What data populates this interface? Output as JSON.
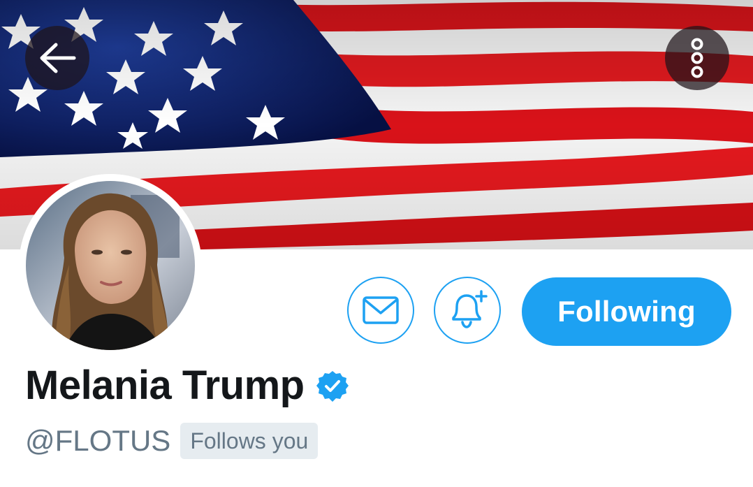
{
  "profile": {
    "display_name": "Melania Trump",
    "handle": "@FLOTUS",
    "follows_you": "Follows you",
    "verified": true
  },
  "actions": {
    "follow_label": "Following",
    "message_icon": "envelope-icon",
    "notify_icon": "bell-plus-icon"
  },
  "navigation": {
    "back_icon": "arrow-left-icon",
    "more_icon": "more-vertical-icon"
  },
  "colors": {
    "accent": "#1da1f2",
    "name_text": "#14171a",
    "secondary_text": "#657786",
    "badge_bg": "#e6ecf0"
  }
}
